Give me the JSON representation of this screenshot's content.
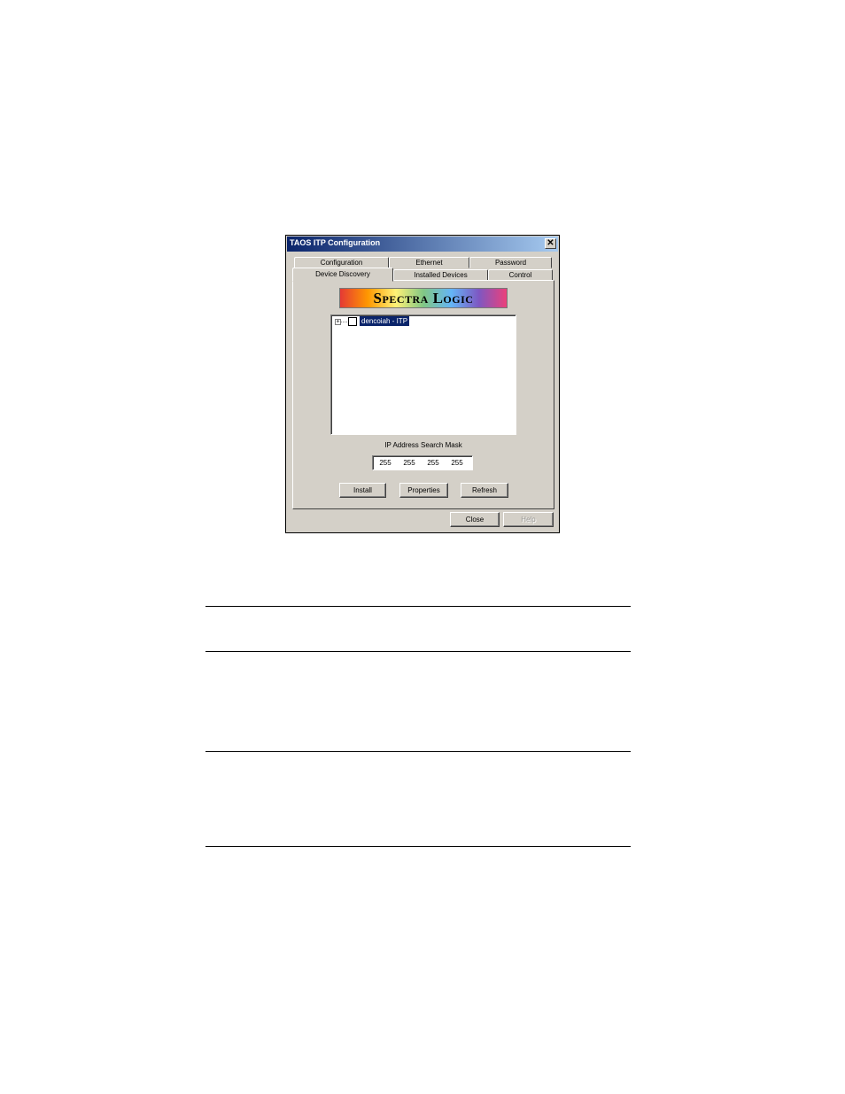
{
  "window": {
    "title": "TAOS ITP Configuration",
    "close_glyph": "✕"
  },
  "tabs": {
    "row_back": [
      "Configuration",
      "Ethernet",
      "Password"
    ],
    "row_front": [
      "Device Discovery",
      "Installed Devices",
      "Control"
    ],
    "active": "Device Discovery"
  },
  "logo": {
    "text": "Spectra Logic"
  },
  "tree": {
    "expander": "+",
    "items": [
      {
        "label": "dencoiah - ITP",
        "checked": false,
        "selected": true
      }
    ]
  },
  "ip_mask": {
    "label": "IP Address Search Mask",
    "octets": [
      "255",
      "255",
      "255",
      "255"
    ]
  },
  "buttons": {
    "install": "Install",
    "properties": "Properties",
    "refresh": "Refresh",
    "close": "Close",
    "help": "Help"
  },
  "colors": {
    "face": "#d4d0c8",
    "title_start": "#0a246a",
    "title_end": "#a6caf0",
    "selection": "#0a246a"
  }
}
